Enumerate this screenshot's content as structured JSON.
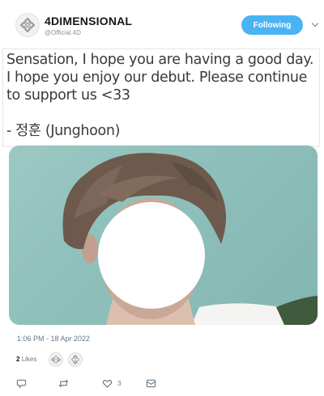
{
  "account": {
    "display_name": "4DIMENSIONAL",
    "handle": "@Official.4D",
    "follow_label": "Following"
  },
  "tweet": {
    "text": "Sensation, I hope you are having a good day. I hope you enjoy our debut. Please continue to support us <33\n\n- 정훈 (Junghoon)",
    "timestamp": "1:06 PM - 18 Apr 2022"
  },
  "engagement": {
    "likes_count": "2",
    "likes_label": "Likes",
    "like_action_count": "3"
  },
  "icons": {
    "reply": "reply-icon",
    "retweet": "retweet-icon",
    "like": "heart-icon",
    "dm": "message-icon",
    "more": "chevron-down-icon"
  },
  "colors": {
    "follow_button": "#4ab3f4",
    "muted_text": "#657786"
  }
}
